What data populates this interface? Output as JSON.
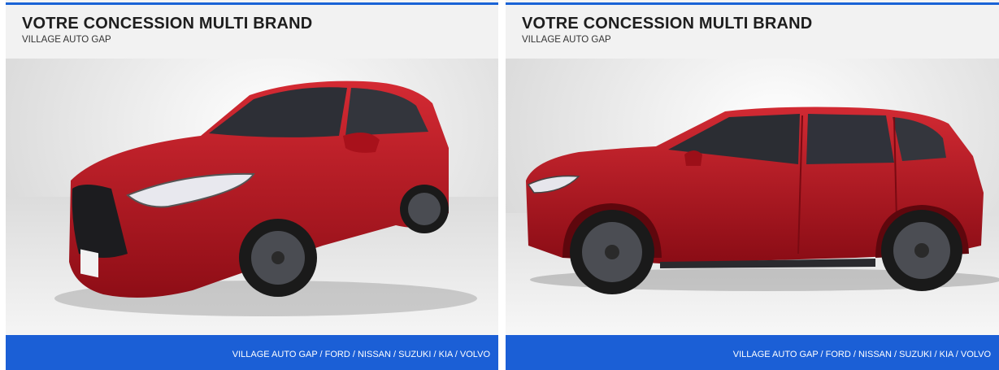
{
  "cards": [
    {
      "title": "VOTRE CONCESSION MULTI BRAND",
      "subtitle": "VILLAGE AUTO GAP",
      "photo_icon": "red-suv-front-three-quarter-photo",
      "footer": "VILLAGE AUTO GAP / FORD / NISSAN / SUZUKI / KIA / VOLVO"
    },
    {
      "title": "VOTRE CONCESSION MULTI BRAND",
      "subtitle": "VILLAGE AUTO GAP",
      "photo_icon": "red-suv-side-profile-photo",
      "footer": "VILLAGE AUTO GAP / FORD / NISSAN / SUZUKI / KIA / VOLVO"
    }
  ],
  "colors": {
    "accent_blue": "#1b5fd6",
    "car_red": "#b3121c"
  }
}
